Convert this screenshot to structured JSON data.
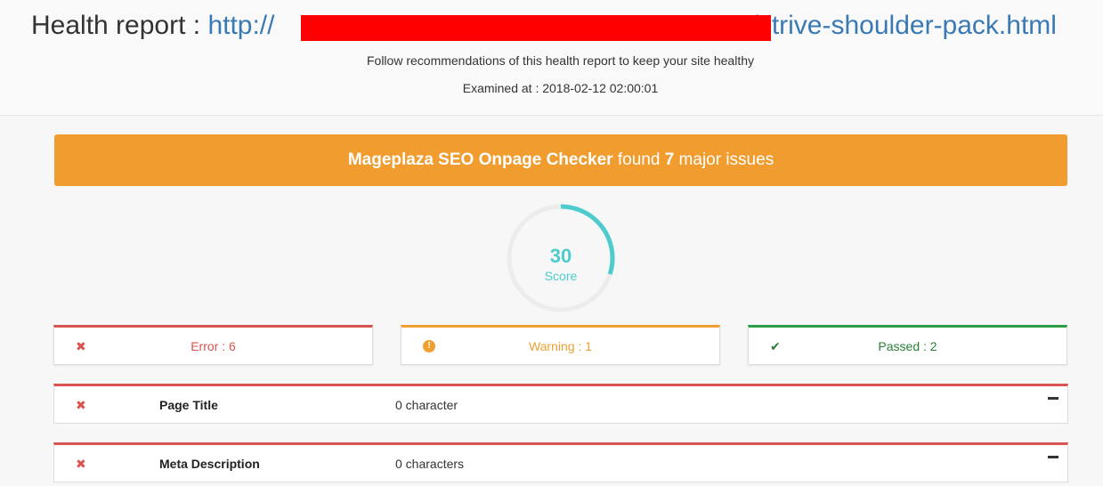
{
  "header": {
    "label": "Health report : ",
    "url_prefix": "http://",
    "url_suffix": "/strive-shoulder-pack.html",
    "subtitle": "Follow recommendations of this health report to keep your site healthy",
    "examined": "Examined at : 2018-02-12 02:00:01"
  },
  "banner": {
    "brand": "Mageplaza SEO Onpage Checker",
    "found": " found ",
    "count": "7",
    "tail": " major issues",
    "color": "#f09c2e"
  },
  "score": {
    "value": "30",
    "label": "Score",
    "fraction": 0.3,
    "color": "#4ecbcd"
  },
  "stats": {
    "error": {
      "text": "Error : 6",
      "icon": "cross-icon",
      "color": "#d9534f"
    },
    "warning": {
      "text": "Warning : 1",
      "icon": "exclamation-circle-icon",
      "color": "#f0a030"
    },
    "passed": {
      "text": "Passed : 2",
      "icon": "check-icon",
      "color": "#2a7f36"
    }
  },
  "checks": [
    {
      "name": "Page Title",
      "value": "0 character",
      "status": "error"
    },
    {
      "name": "Meta Description",
      "value": "0 characters",
      "status": "error"
    }
  ]
}
